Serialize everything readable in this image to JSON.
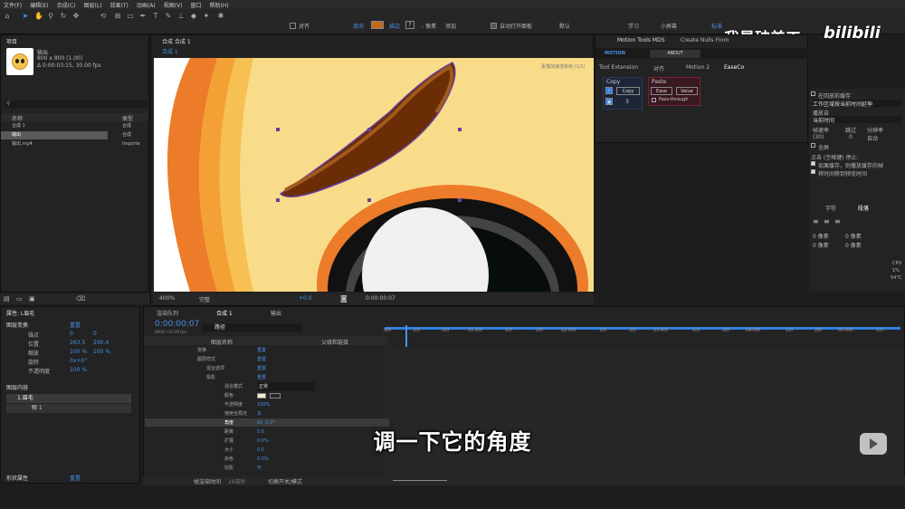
{
  "menu": [
    "文件(F)",
    "编辑(E)",
    "合成(C)",
    "图层(L)",
    "效果(T)",
    "动画(A)",
    "视图(V)",
    "窗口",
    "帮助(H)"
  ],
  "toolbar": {
    "align": "对齐",
    "fill": "填充",
    "stroke": "描边",
    "px_label": "- 像素",
    "add": "添加",
    "auto_open": "自动打开面板",
    "default": "默认",
    "learn": "学习",
    "small_screen": "小屏幕",
    "standard": "标准"
  },
  "watermark": {
    "text": "我是破美工",
    "logo": "bilibili"
  },
  "project": {
    "title": "项目",
    "comp_name": "输出",
    "comp_size": "800 x 800 (1.00)",
    "comp_duration": "Δ 0:00:03:15, 30.00 fps",
    "col_name": "名称",
    "col_type": "类型",
    "items": [
      {
        "name": "合成 1",
        "type": "合成"
      },
      {
        "name": "输出",
        "type": "合成"
      },
      {
        "name": "输出.mp4",
        "type": "Importe"
      }
    ]
  },
  "viewer": {
    "tab": "合成 合成 1",
    "sub_tab": "合成 1",
    "zoom": "400%",
    "quality": "完整",
    "timecode": "0:00:00:07",
    "offset": "+0.0",
    "fast_preview": "素描加速渲染帧 (1/1)"
  },
  "motion_tools": {
    "tab1": "Motion Tools MDS",
    "tab2": "Create Nulls From",
    "brand": "MOTION",
    "about": "ABOUT",
    "tabs": [
      "Tool Extension",
      "对齐",
      "Motion 2",
      "EaseCo"
    ],
    "copy_title": "Copy",
    "copy_btn": "Copy",
    "paste_title": "Paste",
    "ease_btn": "Ease",
    "value_btn": "Value",
    "pass_through": "Pass-through",
    "count": "3"
  },
  "preview": {
    "back_cache": "在回放前缓存",
    "range": "工作区域按当前时间延伸",
    "play_from": "播放自",
    "current_time": "当前时间",
    "fps_label": "帧速率",
    "skip": "跳过",
    "resolution": "分辨率",
    "fps_val": "(30)",
    "skip_val": "0",
    "res_val": "自动",
    "fullscreen": "全屏",
    "stop_label": "点击 (空格键) 停止:",
    "cache_opt": "如果缓存，则播放缓存的帧",
    "move_time": "将时间移到预览时间"
  },
  "para": {
    "char_tab": "字符",
    "para_tab": "段落",
    "px": "0 像素",
    "cpu": "CPU",
    "cpu_val": "1%",
    "temp": "54°C"
  },
  "props": {
    "title": "属性: L眉毛",
    "transform": "图层变换",
    "reset": "重置",
    "anchor": "锚点",
    "anchor_x": "0",
    "anchor_y": "0",
    "position": "位置",
    "pos_x": "263.5",
    "pos_y": "290.4",
    "scale": "缩放",
    "scale_x": "100 %",
    "scale_y": "100 %",
    "rotation": "旋转",
    "rot_val": "0x+0°",
    "opacity": "不透明度",
    "opacity_val": "100 %",
    "content": "图层内容",
    "layer1": "1.眉毛",
    "layer2": "眼 1",
    "shape": "形状属性",
    "shape_reset": "重置"
  },
  "timeline": {
    "tabs": [
      "渲染队列",
      "合成 1",
      "输出"
    ],
    "timecode": "0:00:00:07",
    "frames": "00007 (30.00 fps)",
    "search": "路径",
    "col_layer": "图层名称",
    "col_parent": "父级和链接",
    "rows": [
      {
        "label": "变换",
        "val": "重置"
      },
      {
        "label": "图层样式",
        "val": "重置"
      },
      {
        "label": "混合选项",
        "val": "重置"
      },
      {
        "label": "投影",
        "val": "重置"
      },
      {
        "label": "混合模式",
        "val": "正常"
      },
      {
        "label": "颜色",
        "val": ""
      },
      {
        "label": "不透明度",
        "val": "100%"
      },
      {
        "label": "使用全局光",
        "val": "关"
      },
      {
        "label": "角度",
        "val": "0x -1.0°"
      },
      {
        "label": "距离",
        "val": "5.0"
      },
      {
        "label": "扩展",
        "val": "0.0%"
      },
      {
        "label": "大小",
        "val": "0.0"
      },
      {
        "label": "杂色",
        "val": "0.0%"
      },
      {
        "label": "挖影",
        "val": "开"
      }
    ],
    "ticks": [
      "00f",
      "10f",
      "20f",
      "01:00f",
      "10f",
      "20f",
      "02:00f",
      "10f",
      "20f",
      "03:00f",
      "10f",
      "20f",
      "04:00f",
      "10f",
      "20f",
      "05:00f",
      "10f"
    ],
    "footer_left": "帧渲染时间",
    "footer_ms": "26毫秒",
    "footer_mode": "切换开关/模式"
  },
  "caption": "调一下它的角度",
  "colors": {
    "accent": "#2f7ee0",
    "panel": "#232323",
    "stroke": "#c46a1a"
  }
}
